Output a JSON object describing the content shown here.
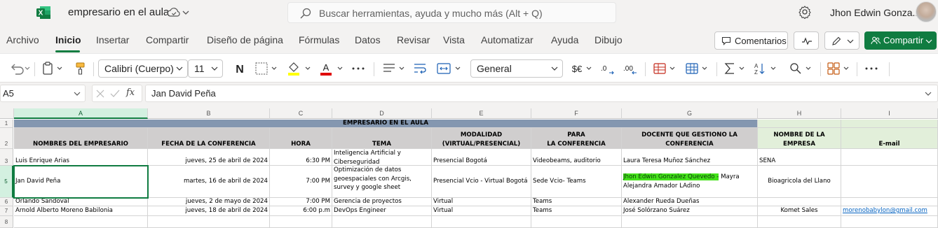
{
  "app": {
    "doc_title": "empresario en el aula",
    "search_placeholder": "Buscar herramientas, ayuda y mucho más (Alt + Q)",
    "user_name": "Jhon Edwin Gonza...",
    "brand_color": "#107c41"
  },
  "menu": {
    "tabs": [
      "Archivo",
      "Inicio",
      "Insertar",
      "Compartir",
      "Diseño de página",
      "Fórmulas",
      "Datos",
      "Revisar",
      "Vista",
      "Automatizar",
      "Ayuda",
      "Dibujo"
    ],
    "active_tab": "Inicio",
    "comments_label": "Comentarios",
    "share_label": "Compartir"
  },
  "ribbon": {
    "font_name": "Calibri (Cuerpo)",
    "font_size": "11",
    "number_format": "General",
    "icons": [
      "undo-icon",
      "paste-icon",
      "format-painter-icon",
      "bold-icon",
      "borders-icon",
      "fill-color-icon",
      "font-color-icon",
      "more-icon",
      "align-icon",
      "wrap-text-icon",
      "merge-icon",
      "currency-icon",
      "increase-decimal-icon",
      "decrease-decimal-icon",
      "conditional-format-icon",
      "format-as-table-icon",
      "autosum-icon",
      "sort-filter-icon",
      "find-icon",
      "addins-icon",
      "more-icon"
    ]
  },
  "formula_bar": {
    "name_box": "A5",
    "formula": "Jan David Peña",
    "fx": "fx"
  },
  "sheet": {
    "columns": [
      "A",
      "B",
      "C",
      "D",
      "E",
      "F",
      "G",
      "H",
      "I"
    ],
    "rows": [
      "1",
      "2",
      "3",
      "5",
      "6",
      "7",
      "8"
    ],
    "title": "EMPRESARIO EN EL AULA",
    "headers": {
      "a": "NOMBRES DEL EMPRESARIO",
      "b": "FECHA DE LA CONFERENCIA",
      "c": "HORA",
      "d": "TEMA",
      "e1": "MODALIDAD",
      "e2": "(VIRTUAL/PRESENCIAL)",
      "f1": "RECURSOS SOLICITADOS PARA",
      "f2": "LA CONFERENCIA",
      "g": "DOCENTE QUE GESTIONO LA CONFERENCIA",
      "h": "NOMBRE DE LA EMPRESA",
      "i": "E-mail"
    },
    "data": [
      {
        "a": "Luis Enrique Arias",
        "b": "jueves, 25 de abril de 2024",
        "c": "6:30 PM",
        "d": "Inteligencia Artificial y Ciberseguridad",
        "e": "Presencial Bogotá",
        "f": "Videobeams, auditorio",
        "g": "Laura Teresa Muñoz Sánchez",
        "h": "SENA",
        "i": ""
      },
      {
        "a": "Jan David Peña",
        "b": "martes, 16 de abril de 2024",
        "c": "7:00 PM",
        "d": "Optimización de datos geoespaciales con Arcgis, survey y google sheet",
        "e": "Presencial Vcio - Virtual Bogotá",
        "f": "Sede Vcio- Teams",
        "g_hl": "Jhon Edwin Gonzalez Quevedo -",
        "g": " Mayra Alejandra Amador LAdino",
        "h": "Bioagricola del Llano",
        "i": ""
      },
      {
        "a": "Orlando Sandoval",
        "b": "jueves, 2 de mayo de 2024",
        "c": "7:00 PM",
        "d": "Gerencia de proyectos",
        "e": "Virtual",
        "f": "Teams",
        "g": "Alexander Rueda Dueñas",
        "h": "",
        "i": ""
      },
      {
        "a": "Arnold Alberto Moreno Babilonia",
        "b": "jueves, 18 de abril de 2024",
        "c": "6:00 p.m",
        "d": "DevOps Engineer",
        "e": "Virtual",
        "f": "Teams",
        "g": "José Solórzano Suárez",
        "h": "Komet Sales",
        "i": "morenobabylon@gmail.com"
      }
    ]
  }
}
